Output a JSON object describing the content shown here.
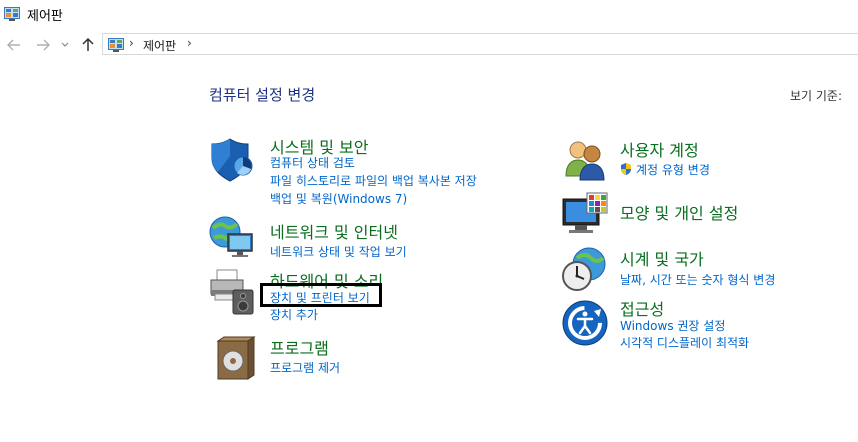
{
  "window": {
    "title": "제어판"
  },
  "navigation": {
    "back_icon": "arrow-left-icon",
    "forward_icon": "arrow-right-icon",
    "recent_icon": "chevron-down-icon",
    "up_icon": "arrow-up-icon"
  },
  "address": {
    "icon": "control-panel-icon",
    "separator": "›",
    "crumb": "제어판",
    "trailing_separator": "›"
  },
  "main": {
    "heading": "컴퓨터 설정 변경",
    "view_by": "보기 기준:"
  },
  "categories": {
    "system_security": {
      "title": "시스템 및 보안",
      "links": [
        "컴퓨터 상태 검토",
        "파일 히스토리로 파일의 백업 복사본 저장",
        "백업 및 복원(Windows 7)"
      ]
    },
    "network": {
      "title": "네트워크 및 인터넷",
      "links": [
        "네트워크 상태 및 작업 보기"
      ]
    },
    "hardware": {
      "title": "하드웨어 및 소리",
      "links": [
        "장치 및 프린터 보기",
        "장치 추가"
      ]
    },
    "programs": {
      "title": "프로그램",
      "links": [
        "프로그램 제거"
      ]
    },
    "user_accounts": {
      "title": "사용자 계정",
      "links": [
        "계정 유형 변경"
      ]
    },
    "appearance": {
      "title": "모양 및 개인 설정",
      "links": []
    },
    "clock_region": {
      "title": "시계 및 국가",
      "links": [
        "날짜, 시간 또는 숫자 형식 변경"
      ]
    },
    "ease_of_access": {
      "title": "접근성",
      "links": [
        "Windows 권장 설정",
        "시각적 디스플레이 최적화"
      ]
    }
  },
  "colors": {
    "heading": "#1e3287",
    "category_title": "#0a6e1e",
    "link": "#0066cc"
  }
}
